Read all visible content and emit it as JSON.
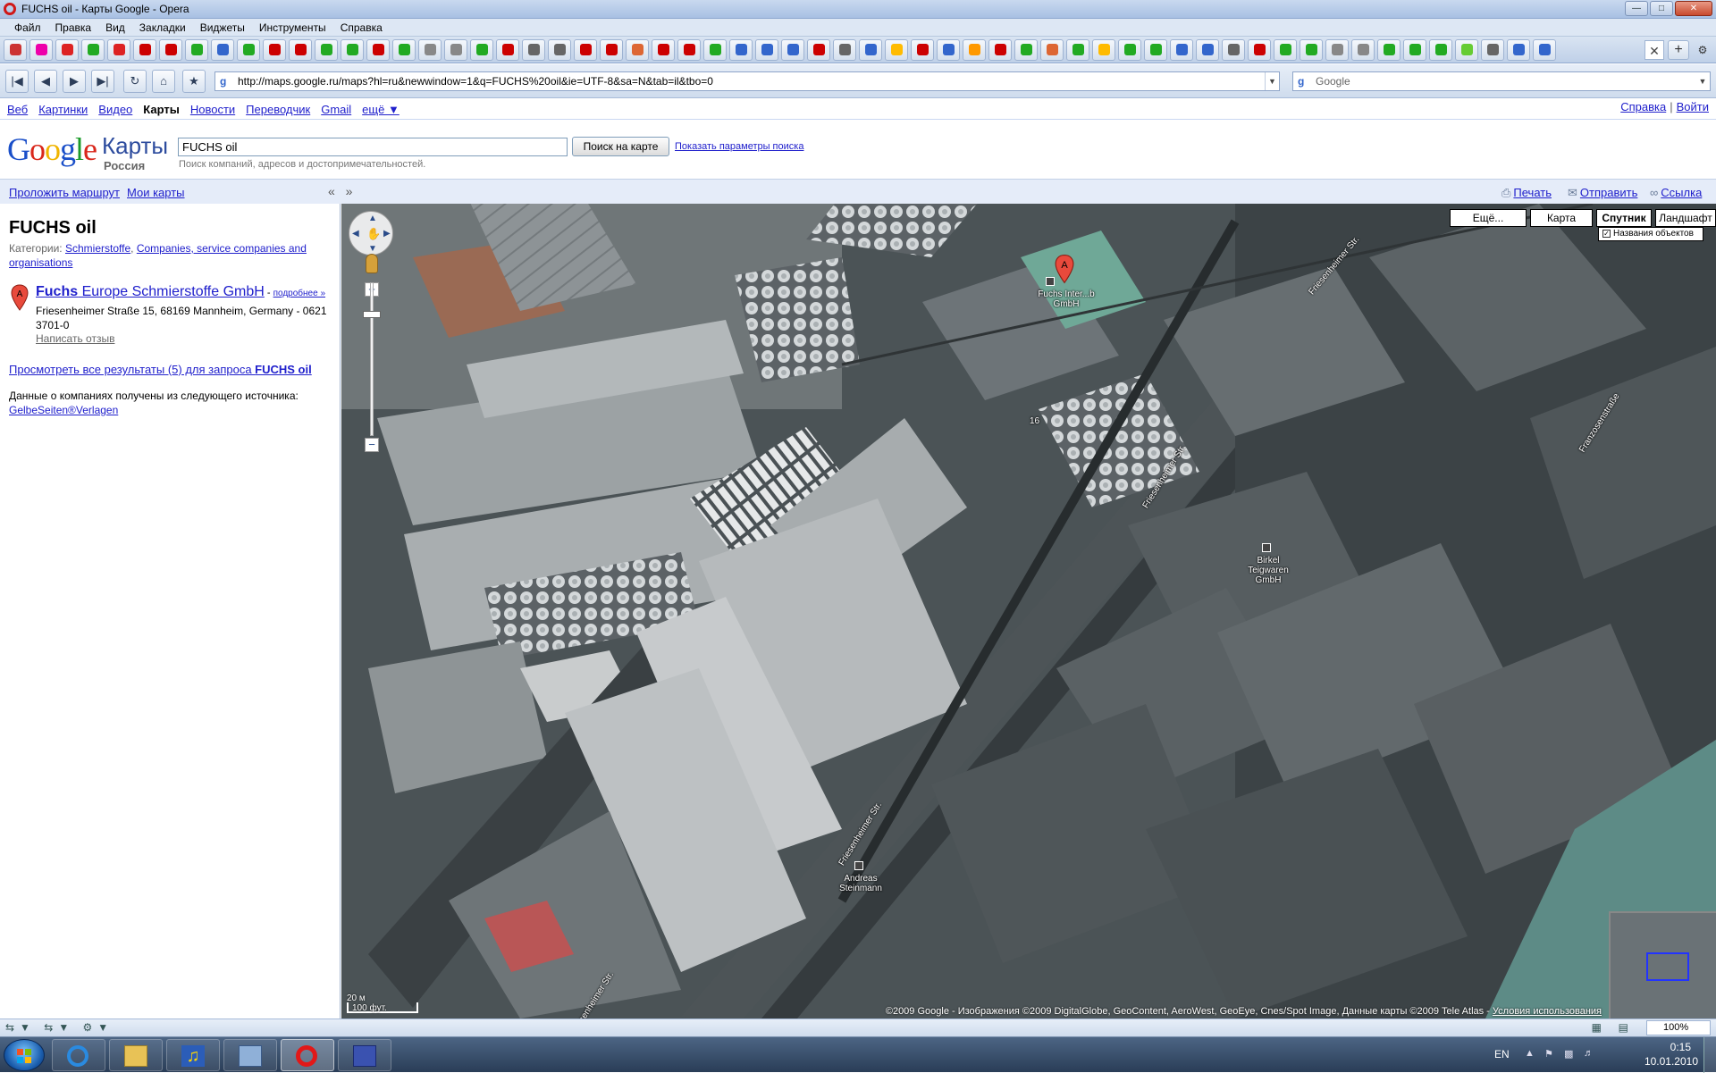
{
  "window": {
    "title": "FUCHS oil - Карты Google - Opera"
  },
  "menu": [
    "Файл",
    "Правка",
    "Вид",
    "Закладки",
    "Виджеты",
    "Инструменты",
    "Справка"
  ],
  "tabs": {
    "icon_colors": [
      "#c33",
      "#e0a",
      "#d22",
      "#2a2",
      "#d22",
      "#c00",
      "#c00",
      "#2a2",
      "#36c",
      "#2a2",
      "#c00",
      "#c00",
      "#2a2",
      "#2a2",
      "#c00",
      "#2a2",
      "#888",
      "#888",
      "#2a2",
      "#c00",
      "#666",
      "#666",
      "#c00",
      "#c00",
      "#d63",
      "#c00",
      "#c00",
      "#2a2",
      "#36c",
      "#36c",
      "#36c",
      "#c00",
      "#666",
      "#36c",
      "#fb0",
      "#c00",
      "#36c",
      "#f90",
      "#c00",
      "#2a2",
      "#d63",
      "#2a2",
      "#fb0",
      "#2a2",
      "#2a2",
      "#36c",
      "#36c",
      "#666",
      "#c00",
      "#2a2",
      "#2a2",
      "#888",
      "#888",
      "#2a2",
      "#2a2",
      "#2a2",
      "#6c3",
      "#666",
      "#36c",
      "#36c"
    ],
    "active_index": 60
  },
  "address": {
    "url": "http://maps.google.ru/maps?hl=ru&newwindow=1&q=FUCHS%20oil&ie=UTF-8&sa=N&tab=il&tbo=0",
    "search_engine": "Google"
  },
  "gbar": {
    "links": [
      "Веб",
      "Картинки",
      "Видео",
      "Карты",
      "Новости",
      "Переводчик",
      "Gmail",
      "ещё ▼"
    ],
    "current": "Карты",
    "help": "Справка",
    "login": "Войти",
    "separator": "|"
  },
  "header": {
    "logo": "Google",
    "product": "Карты",
    "country": "Россия",
    "query": "FUCHS oil",
    "search_button": "Поиск на карте",
    "options_link": "Показать параметры поиска",
    "hint": "Поиск компаний, адресов и достопримечательностей."
  },
  "subbar": {
    "directions": "Проложить маршрут",
    "my_maps": "Мои карты",
    "collapse": "« »",
    "print": "Печать",
    "send": "Отправить",
    "link": "Ссылка"
  },
  "sidebar": {
    "heading": "FUCHS oil",
    "categories_label": "Категории:",
    "categories": [
      "Schmierstoffe",
      "Companies, service companies and organisations"
    ],
    "category_separator": ", ",
    "result": {
      "marker": "A",
      "name_bold": "Fuchs",
      "name_rest": " Europe Schmierstoffe GmbH",
      "more": "подробнее »",
      "dash": " - ",
      "address": "Friesenheimer Straße 15, 68169 Mannheim, Germany - 0621 3701-0",
      "review": "Написать отзыв"
    },
    "all_results_prefix": "Просмотреть все результаты (5) для запроса ",
    "all_results_query": "FUCHS oil",
    "source_text": "Данные о компаниях получены из следующего источника:",
    "source_link": "GelbeSeiten®Verlagen"
  },
  "map": {
    "types": [
      "Ещё...",
      "Карта",
      "Спутник",
      "Ландшафт"
    ],
    "active_type": "Спутник",
    "labels_checkbox": "Названия объектов",
    "labels_checked": true,
    "marker": "A",
    "street_labels": {
      "s1": "Friesenheimer Str.",
      "s2": "Friesenheimer Str.",
      "s3": "Friesenheimer Str.",
      "s4": "Friesenheimer Str.",
      "s5": "Franzosenstraße"
    },
    "poi_labels": {
      "fuchs": "Fuchs Inter...b GmbH",
      "birkel": "Birkel Teigwaren GmbH",
      "andreas": "Andreas Steinmann",
      "road_num": "16"
    },
    "scale_top": "20 м",
    "scale_bottom": "100 фут.",
    "copyright": "©2009 Google - Изображения ©2009 DigitalGlobe, GeoContent, AeroWest, GeoEye, Cnes/Spot Image, Данные карты ©2009 Tele Atlas - ",
    "terms": "Условия использования"
  },
  "statusbar": {
    "zoom": "100%"
  },
  "taskbar": {
    "lang": "EN",
    "time": "0:15",
    "date": "10.01.2010"
  }
}
